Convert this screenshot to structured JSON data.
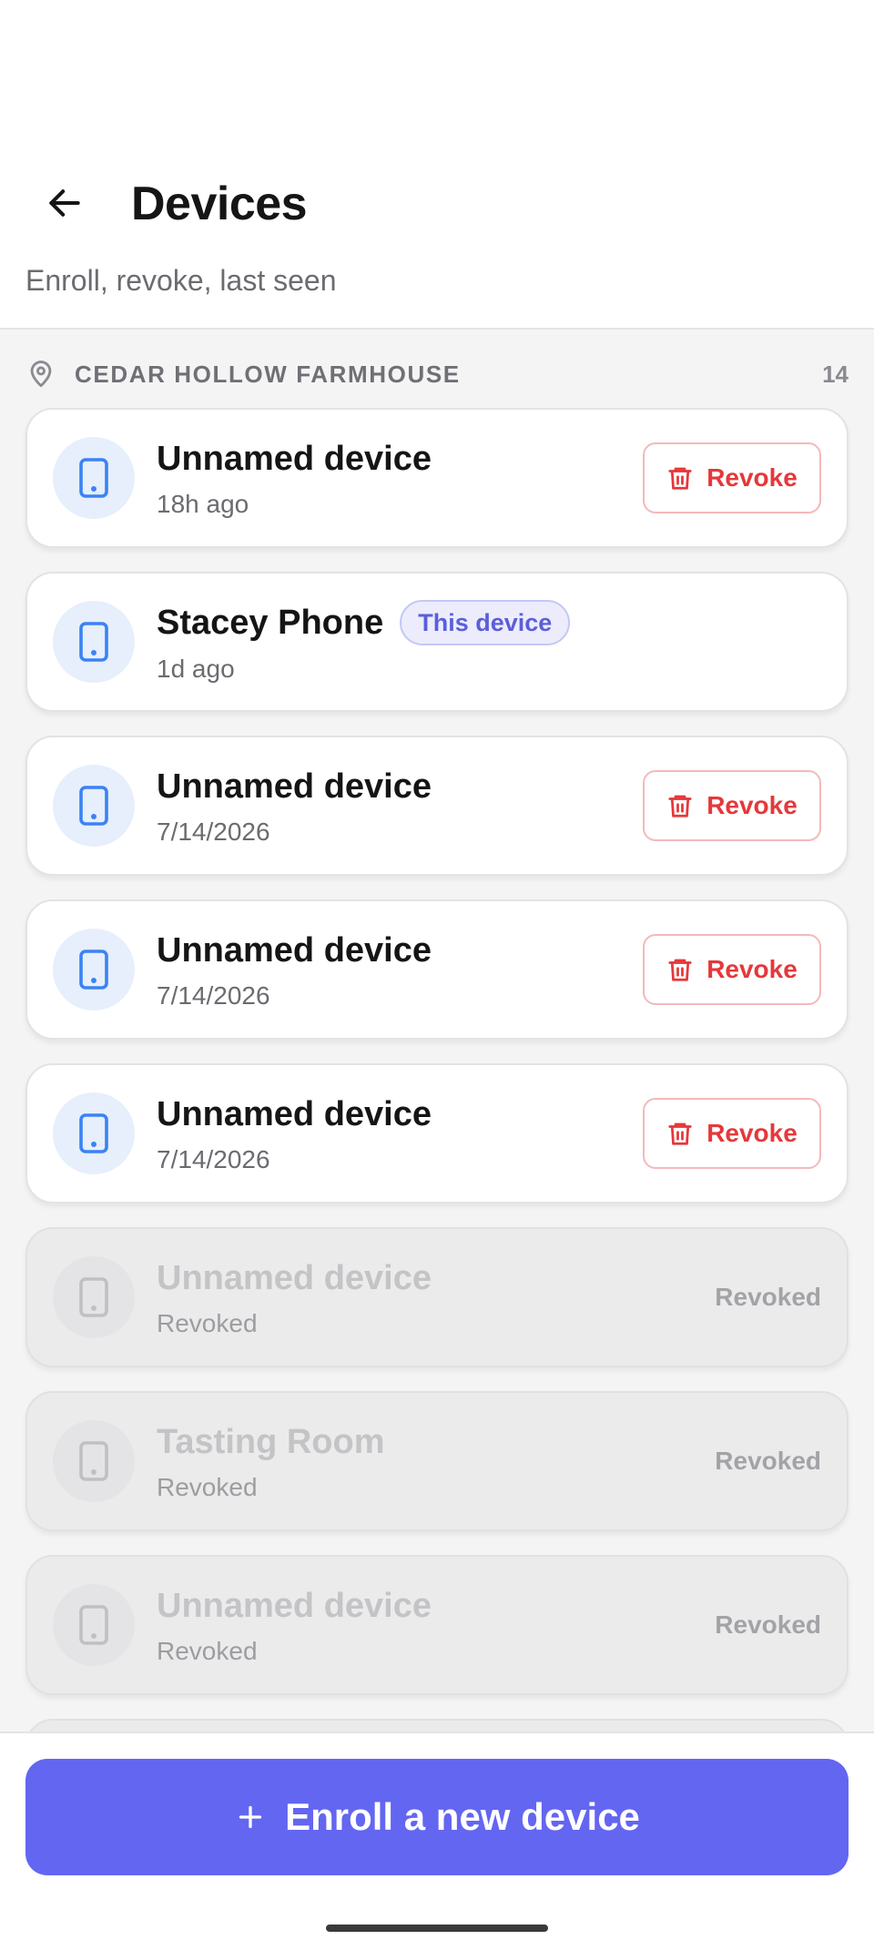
{
  "header": {
    "title": "Devices",
    "subtitle": "Enroll, revoke, last seen"
  },
  "section": {
    "label": "CEDAR HOLLOW FARMHOUSE",
    "count": "14"
  },
  "devices": [
    {
      "name": "Unnamed device",
      "meta": "18h ago",
      "action": "Revoke",
      "revoked": false
    },
    {
      "name": "Stacey Phone",
      "meta": "1d ago",
      "badge": "This device",
      "revoked": false
    },
    {
      "name": "Unnamed device",
      "meta": "7/14/2026",
      "action": "Revoke",
      "revoked": false
    },
    {
      "name": "Unnamed device",
      "meta": "7/14/2026",
      "action": "Revoke",
      "revoked": false
    },
    {
      "name": "Unnamed device",
      "meta": "7/14/2026",
      "action": "Revoke",
      "revoked": false
    },
    {
      "name": "Unnamed device",
      "meta": "Revoked",
      "status": "Revoked",
      "revoked": true
    },
    {
      "name": "Tasting Room",
      "meta": "Revoked",
      "status": "Revoked",
      "revoked": true
    },
    {
      "name": "Unnamed device",
      "meta": "Revoked",
      "status": "Revoked",
      "revoked": true
    }
  ],
  "enroll_button": {
    "label": "Enroll a new device"
  },
  "colors": {
    "accent": "#6366f1",
    "danger": "#e5383b",
    "device_icon": "#3b82f6",
    "badge_text": "#5b5fd8"
  },
  "icons": {
    "back": "arrow-left-icon",
    "location": "map-pin-icon",
    "device": "smartphone-icon",
    "revoke": "trash-icon",
    "enroll": "plus-icon"
  }
}
